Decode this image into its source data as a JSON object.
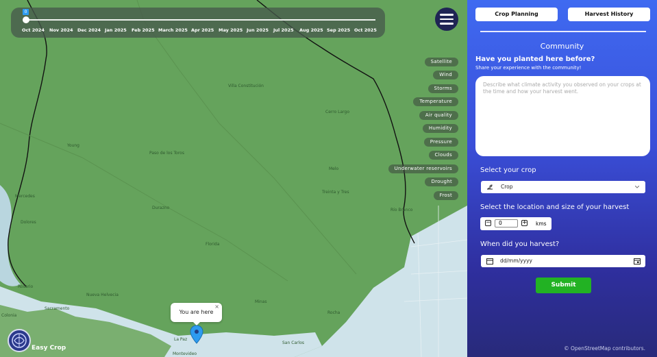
{
  "timeline": {
    "value": "0",
    "months": [
      "Oct 2024",
      "Nov 2024",
      "Dec 2024",
      "Jan 2025",
      "Feb 2025",
      "March 2025",
      "Apr 2025",
      "May 2025",
      "Jun 2025",
      "Jul 2025",
      "Aug 2025",
      "Sep 2025",
      "Oct 2025"
    ]
  },
  "layers": [
    "Satellite",
    "Wind",
    "Storms",
    "Temperature",
    "Air quality",
    "Humidity",
    "Pressure",
    "Clouds",
    "Underwater reservoirs",
    "Drought",
    "Frost"
  ],
  "map": {
    "popup_text": "You are here",
    "popup_close": "×",
    "brand": "Easy Crop",
    "cities": [
      "Sacramento",
      "Young",
      "Rosario",
      "Dolores",
      "Mercedes",
      "Durazno",
      "Florida",
      "Minas",
      "Rocha",
      "Treinta y Tres",
      "Melo",
      "Colonia",
      "Nueva Helvecia",
      "Montevideo",
      "San Carlos",
      "La Paz",
      "Río Branco",
      "Cerro Largo",
      "Paso de los Toros",
      "Villa Constitución"
    ],
    "colors": {
      "land": "#65a35c",
      "water": "#cfe3ea",
      "border": "#111111"
    }
  },
  "panel": {
    "tab_crop_planning": "Crop Planning",
    "tab_harvest_history": "Harvest History",
    "community_title": "Community",
    "question": "Have you planted here before?",
    "question_sub": "Share your experience with the community!",
    "textarea_placeholder": "Describe what climate activity you observed on your crops at the time and how your harvest went.",
    "crop_label": "Select your crop",
    "crop_value": "Crop",
    "location_label": "Select the location and size of your harvest",
    "stepper_value": "0",
    "stepper_minus": "−",
    "stepper_plus": "+",
    "stepper_unit": "kms",
    "date_label": "When did you harvest?",
    "date_placeholder": "dd/mm/yyyy",
    "submit": "Submit",
    "attribution": "© OpenStreetMap contributors."
  }
}
